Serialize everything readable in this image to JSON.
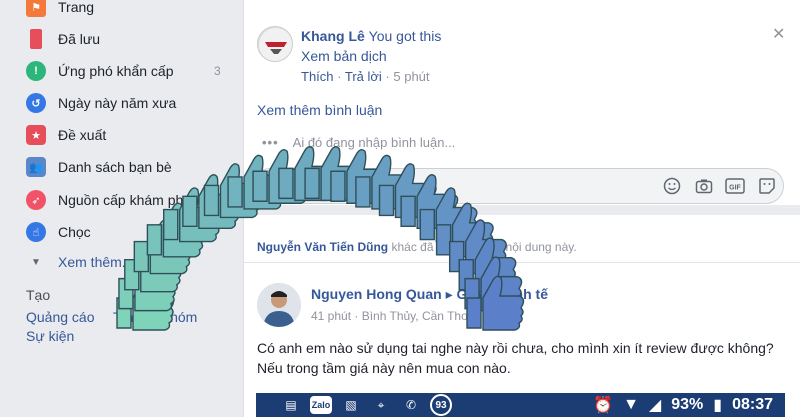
{
  "sidebar": {
    "items": [
      {
        "label": "Trang",
        "icon": "flag-icon",
        "color": "#f5793a"
      },
      {
        "label": "Đã lưu",
        "icon": "bookmark-icon",
        "color": "#e64e5c"
      },
      {
        "label": "Ứng phó khẩn cấp",
        "icon": "crisis-icon",
        "color": "#2db67c",
        "count": "3"
      },
      {
        "label": "Ngày này năm xưa",
        "icon": "clock-icon",
        "color": "#3578e5"
      },
      {
        "label": "Đề xuất",
        "icon": "star-icon",
        "color": "#e64e5c"
      },
      {
        "label": "Danh sách bạn bè",
        "icon": "friends-icon",
        "color": "#5b87c8"
      },
      {
        "label": "Nguồn cấp khám phá",
        "icon": "rocket-icon",
        "color": "#f25268"
      },
      {
        "label": "Chọc",
        "icon": "poke-icon",
        "color": "#3578e5"
      },
      {
        "label": "Xem thêm...",
        "icon": "chevron-down-icon",
        "color": "#606770"
      }
    ],
    "section_title": "Tạo",
    "create_links": [
      "Quảng cáo",
      "Trang",
      "Nhóm",
      "Sự kiện"
    ]
  },
  "comment": {
    "author": "Khang Lê",
    "text": "You got this",
    "translate": "Xem bản dịch",
    "like": "Thích",
    "reply": "Trả lời",
    "time": "5 phút"
  },
  "more_comments": "Xem thêm bình luận",
  "typing": "Ai đó đang nhập bình luận...",
  "activity": {
    "name": "Nguyễn Văn Tiến Dũng",
    "text": "khác đã bình luận về nội dung này."
  },
  "post": {
    "author": "Nguyen Hong Quan",
    "group": "Group Tinh tế",
    "meta": "41 phút · Bình Thủy, Cần Thơ",
    "body": "Có anh em nào sử dụng tai nghe này rồi chưa, cho mình xin ít review được không? Nếu trong tầm giá này nên mua con nào."
  },
  "phone_status": {
    "zalo": "Zalo",
    "badge": "93",
    "battery": "93%",
    "time": "08:37"
  },
  "colors": {
    "link": "#365899",
    "like_green": "#7fd3b8",
    "like_blue": "#5b7fc9"
  }
}
